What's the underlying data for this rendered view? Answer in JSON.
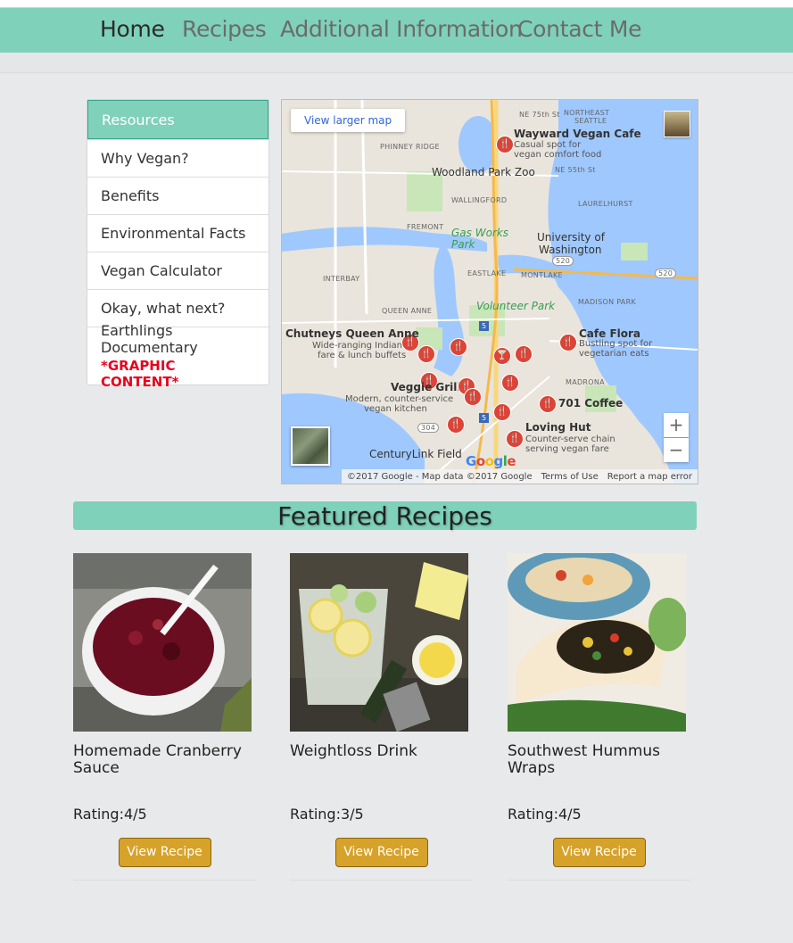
{
  "nav": {
    "items": [
      "Home",
      "Recipes",
      "Additional Information",
      "Contact Me"
    ]
  },
  "sidebar": {
    "items": [
      {
        "label": "Resources"
      },
      {
        "label": "Why Vegan?"
      },
      {
        "label": "Benefits"
      },
      {
        "label": "Environmental Facts"
      },
      {
        "label": "Vegan Calculator"
      },
      {
        "label": "Okay, what next?"
      },
      {
        "label": "Earthlings Documentary",
        "warning": "*GRAPHIC CONTENT*"
      }
    ]
  },
  "map": {
    "larger_map": "View larger map",
    "zoom_in": "+",
    "zoom_out": "−",
    "attribution": "©2017 Google - Map data ©2017 Google",
    "terms": "Terms of Use",
    "report": "Report a map error",
    "google": "Google",
    "places": [
      {
        "name": "Wayward Vegan Cafe",
        "desc1": "Casual spot for",
        "desc2": "vegan comfort food"
      },
      {
        "name": "Chutneys Queen Anne",
        "desc1": "Wide-ranging Indian",
        "desc2": "fare & lunch buffets"
      },
      {
        "name": "Cafe Flora",
        "desc1": "Bustling spot for",
        "desc2": "vegetarian eats"
      },
      {
        "name": "Veggie Grill",
        "desc1": "Modern, counter-service",
        "desc2": "vegan kitchen"
      },
      {
        "name": "701 Coffee",
        "desc1": "",
        "desc2": ""
      },
      {
        "name": "Loving Hut",
        "desc1": "Counter-serve chain",
        "desc2": "serving vegan fare"
      }
    ],
    "labels": {
      "zoo": "Woodland Park Zoo",
      "uw1": "University of",
      "uw2": "Washington",
      "gas1": "Gas Works",
      "gas2": "Park",
      "volunteer": "Volunteer Park",
      "centurylink": "CenturyLink Field",
      "northeast1": "NORTHEAST",
      "northeast2": "SEATTLE",
      "phinney": "PHINNEY RIDGE",
      "wallingford": "WALLINGFORD",
      "laurelhurst": "LAURELHURST",
      "fremont": "FREMONT",
      "eastlake": "EASTLAKE",
      "montlake": "MONTLAKE",
      "madison": "MADISON PARK",
      "queenanne": "QUEEN ANNE",
      "interbay": "INTERBAY",
      "madrona": "MADRONA",
      "ne75": "NE 75th St",
      "ne55": "NE 55th St",
      "r520a": "520",
      "r520b": "520",
      "r5a": "5",
      "r5b": "5",
      "r304": "304"
    }
  },
  "featured": {
    "title": "Featured Recipes",
    "recipes": [
      {
        "title": "Homemade Cranberry Sauce",
        "rating": "Rating:4/5",
        "button": "View Recipe"
      },
      {
        "title": "Weightloss Drink",
        "rating": "Rating:3/5",
        "button": "View Recipe"
      },
      {
        "title": "Southwest Hummus Wraps",
        "rating": "Rating:4/5",
        "button": "View Recipe"
      }
    ]
  }
}
